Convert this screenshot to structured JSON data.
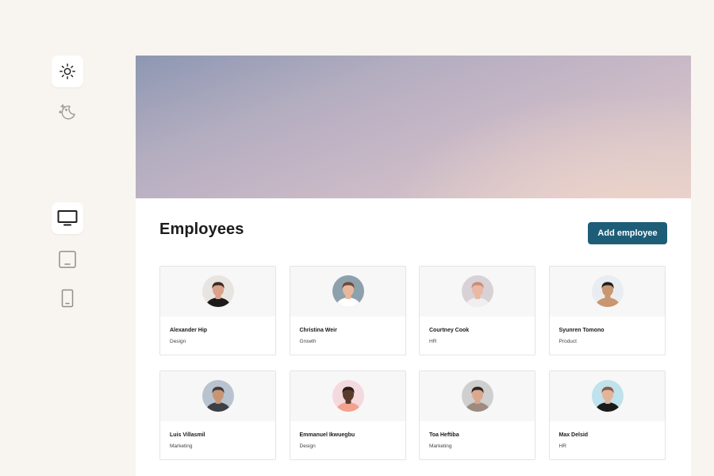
{
  "theme_toggle": {
    "light_icon": "sun-icon",
    "dark_icon": "moon-stars-icon",
    "active": "light"
  },
  "device_toggle": {
    "desktop_icon": "desktop-icon",
    "tablet_icon": "tablet-icon",
    "mobile_icon": "mobile-icon",
    "active": "desktop"
  },
  "main": {
    "title": "Employees",
    "add_button_label": "Add employee",
    "accent_color": "#1e5d78"
  },
  "employees": [
    {
      "name": "Alexander Hip",
      "department": "Design",
      "avatar_bg": "#e8e4df",
      "skin": "#d9a08a",
      "hair": "#3a2a22",
      "shirt": "#1b1b1b"
    },
    {
      "name": "Christina Weir",
      "department": "Growth",
      "avatar_bg": "#8da1ad",
      "skin": "#e9b89c",
      "hair": "#6e4a33",
      "shirt": "#ffffff"
    },
    {
      "name": "Courtney Cook",
      "department": "HR",
      "avatar_bg": "#d8d2d6",
      "skin": "#e9b9a6",
      "hair": "#c98d79",
      "shirt": "#f1eef0"
    },
    {
      "name": "Syunren Tomono",
      "department": "Product",
      "avatar_bg": "#e9edf1",
      "skin": "#c9966f",
      "hair": "#1f1f1f",
      "shirt": "#c9966f"
    },
    {
      "name": "Luis Villasmil",
      "department": "Marketing",
      "avatar_bg": "#b9c3cf",
      "skin": "#c89574",
      "hair": "#3d3c3a",
      "shirt": "#3d3f44"
    },
    {
      "name": "Emmanuel Ikwuegbu",
      "department": "Design",
      "avatar_bg": "#f4d9de",
      "skin": "#5a3a2a",
      "hair": "#2a1c16",
      "shirt": "#f2a28f"
    },
    {
      "name": "Toa Heftiba",
      "department": "Marketing",
      "avatar_bg": "#cfcfcf",
      "skin": "#d9a88e",
      "hair": "#2b2623",
      "shirt": "#9e8a7f"
    },
    {
      "name": "Max Delsid",
      "department": "HR",
      "avatar_bg": "#bfe2ec",
      "skin": "#e2b49b",
      "hair": "#8a5a3c",
      "shirt": "#1a1a1a"
    }
  ]
}
